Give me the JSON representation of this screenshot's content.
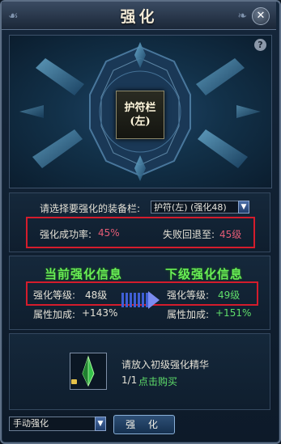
{
  "window": {
    "title": "强化",
    "close_label": "✕"
  },
  "preview": {
    "help_label": "?",
    "slot_label_line1": "护符栏",
    "slot_label_line2": "(左)"
  },
  "selection": {
    "prompt": "请选择要强化的装备栏:",
    "selected_value": "护符(左) (强化48)"
  },
  "rates": {
    "success_label": "强化成功率:",
    "success_value": "45%",
    "fail_label": "失败回退至:",
    "fail_value": "45级"
  },
  "current": {
    "title": "当前强化信息",
    "level_label": "强化等级:",
    "level_value": "48级",
    "bonus_label": "属性加成:",
    "bonus_value": "+143%"
  },
  "next": {
    "title": "下级强化信息",
    "level_label": "强化等级:",
    "level_value": "49级",
    "bonus_label": "属性加成:",
    "bonus_value": "+151%"
  },
  "material": {
    "prompt": "请放入初级强化精华",
    "count": "1/1",
    "buy_link": "点击购买"
  },
  "footer": {
    "mode_value": "手动强化",
    "strengthen_button": "强 化"
  },
  "colors": {
    "accent_red": "#e35b75",
    "accent_green": "#5fde6a",
    "highlight_box": "#d41c2c"
  }
}
